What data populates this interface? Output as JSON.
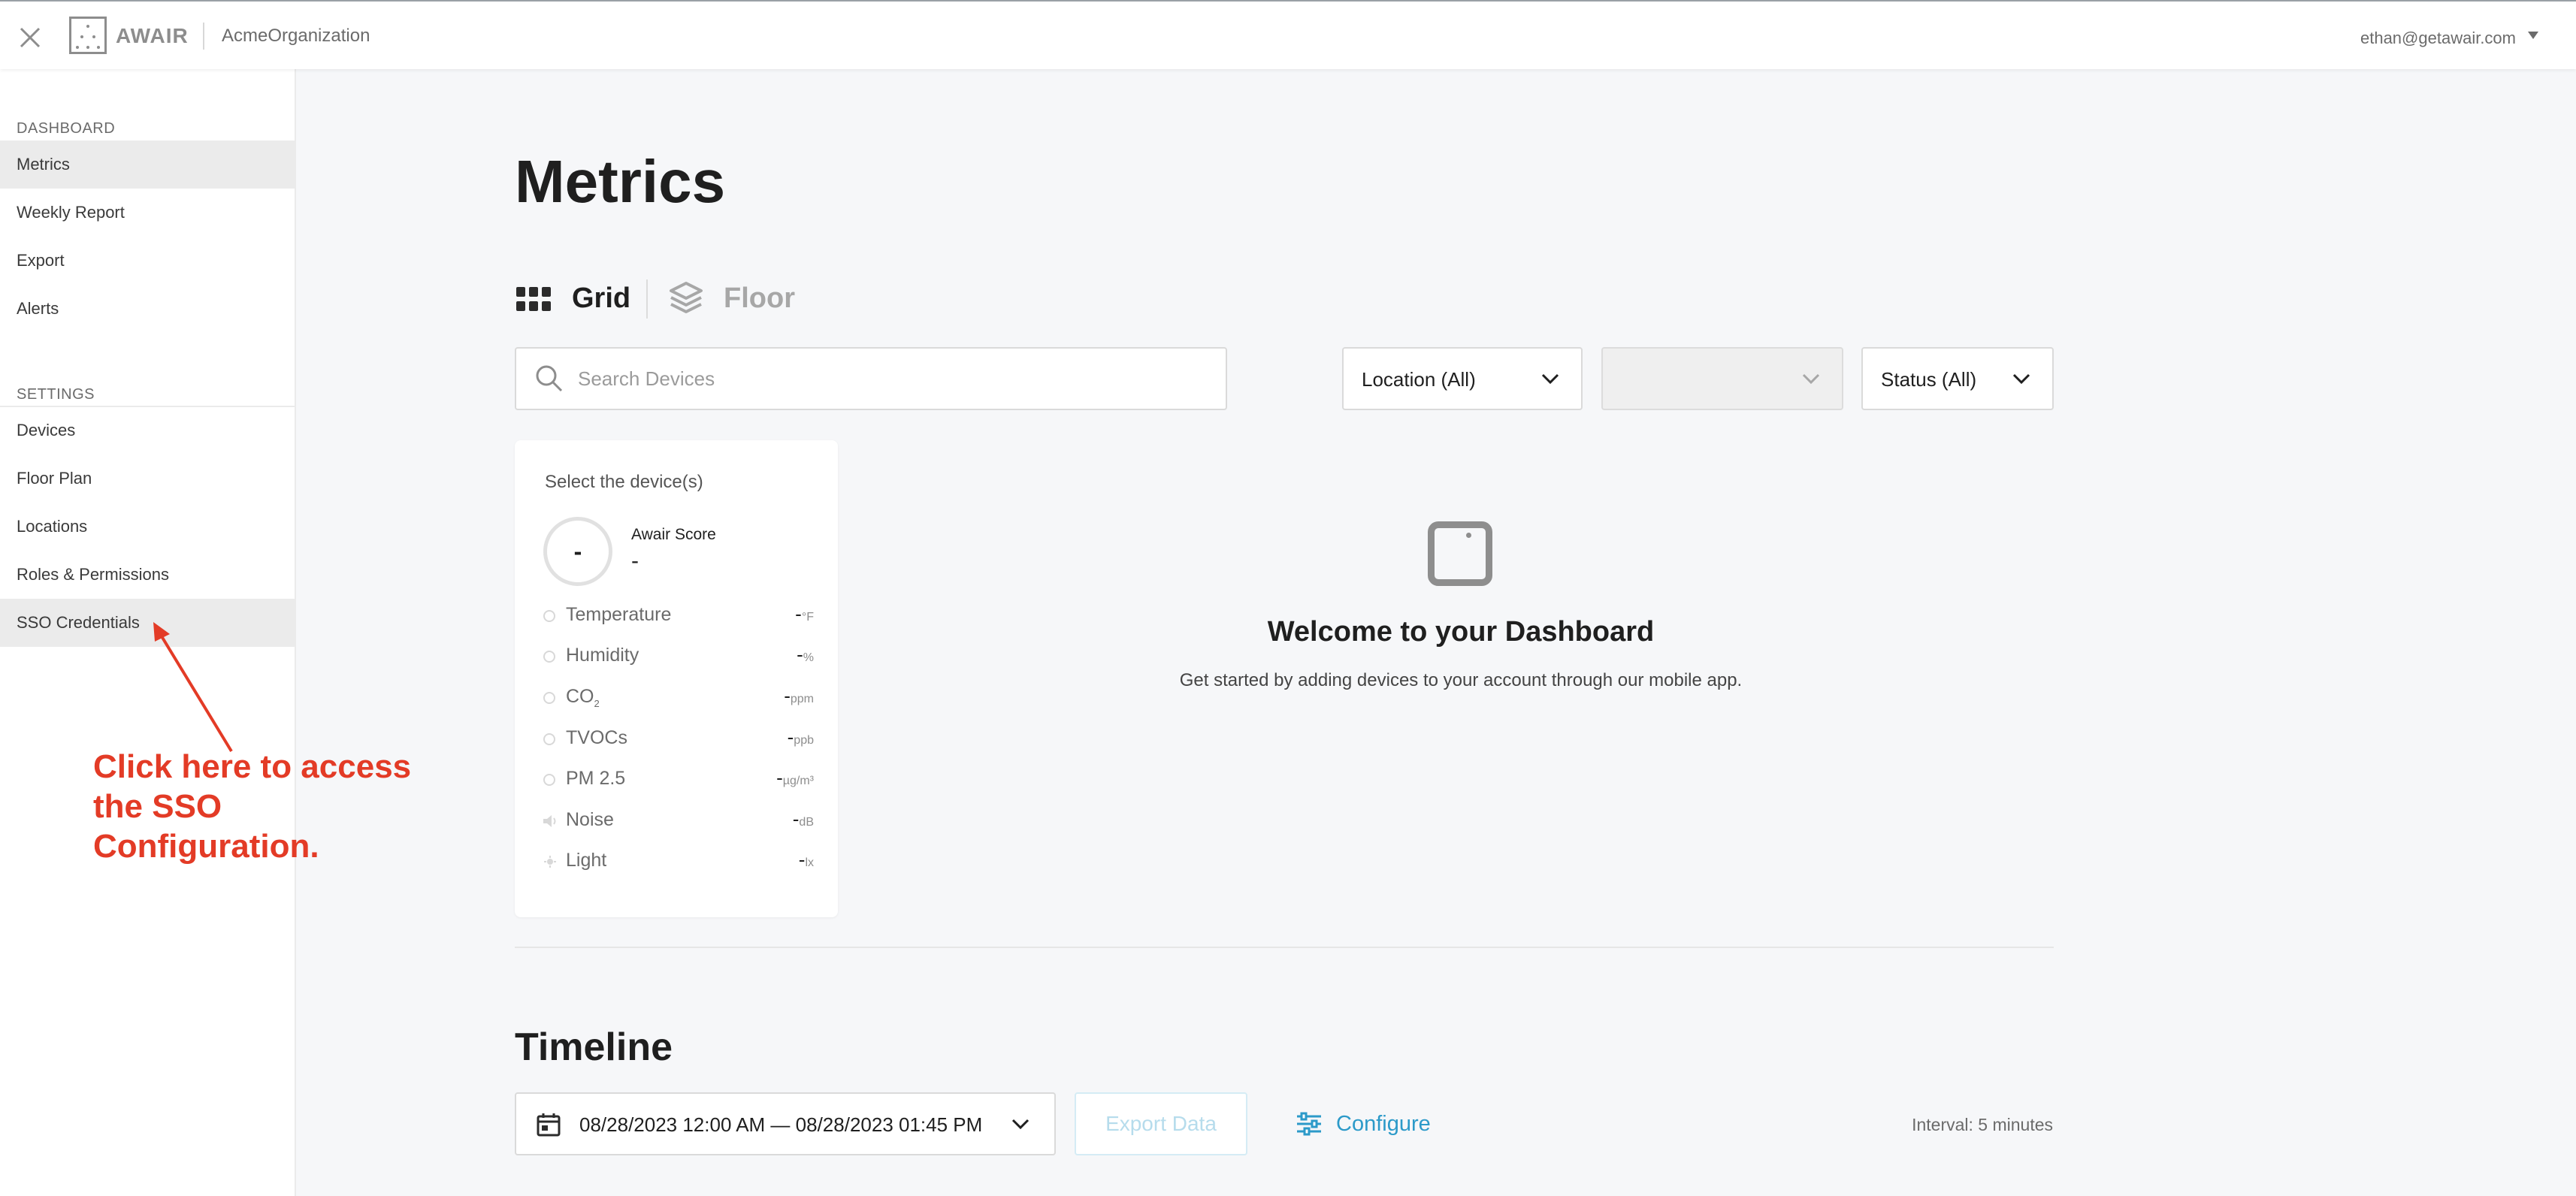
{
  "header": {
    "logo_text": "AWAIR",
    "org_name": "AcmeOrganization",
    "user_email": "ethan@getawair.com"
  },
  "sidebar": {
    "dashboard_heading": "DASHBOARD",
    "dashboard_items": [
      {
        "label": "Metrics",
        "active": true
      },
      {
        "label": "Weekly Report"
      },
      {
        "label": "Export"
      },
      {
        "label": "Alerts"
      }
    ],
    "settings_heading": "SETTINGS",
    "settings_items": [
      {
        "label": "Devices"
      },
      {
        "label": "Floor Plan"
      },
      {
        "label": "Locations"
      },
      {
        "label": "Roles & Permissions"
      },
      {
        "label": "SSO Credentials",
        "highlighted": true
      }
    ]
  },
  "annotation": {
    "lines": [
      "Click here to access",
      "the SSO",
      "Configuration."
    ],
    "color": "#e33b26"
  },
  "main": {
    "title": "Metrics",
    "views": [
      {
        "label": "Grid",
        "icon": "grid-icon",
        "active": true
      },
      {
        "label": "Floor",
        "icon": "layers-icon",
        "active": false
      }
    ],
    "search": {
      "placeholder": "Search Devices",
      "value": ""
    },
    "filters": [
      {
        "label": "Location (All)"
      },
      {
        "label": "",
        "disabled": true
      },
      {
        "label": "Status (All)"
      }
    ]
  },
  "device_card": {
    "title": "Select the device(s)",
    "score": {
      "ring_value": "-",
      "label": "Awair Score",
      "value": "-"
    },
    "metrics": [
      {
        "name": "Temperature",
        "value": "-",
        "unit": "°F"
      },
      {
        "name": "Humidity",
        "value": "-",
        "unit": "%"
      },
      {
        "name": "CO",
        "subscript": "2",
        "value": "-",
        "unit": "ppm"
      },
      {
        "name": "TVOCs",
        "value": "-",
        "unit": "ppb"
      },
      {
        "name": "PM 2.5",
        "value": "-",
        "unit": "µg/m³"
      },
      {
        "name": "Noise",
        "value": "-",
        "unit": "dB",
        "icon": "speaker-icon"
      },
      {
        "name": "Light",
        "value": "-",
        "unit": "lx",
        "icon": "sun-icon"
      }
    ]
  },
  "empty_state": {
    "icon": "awair-device-icon",
    "title": "Welcome to your Dashboard",
    "subtitle": "Get started by adding devices to your account through our mobile app."
  },
  "timeline": {
    "title": "Timeline",
    "date_range": "08/28/2023 12:00 AM — 08/28/2023 01:45 PM",
    "export_label": "Export Data",
    "configure_label": "Configure",
    "interval": "Interval: 5 minutes"
  },
  "colors": {
    "accent": "#2c9ac9",
    "annotation": "#e33b26",
    "sidebar_active": "#ebebeb",
    "background": "#f6f7f9"
  }
}
